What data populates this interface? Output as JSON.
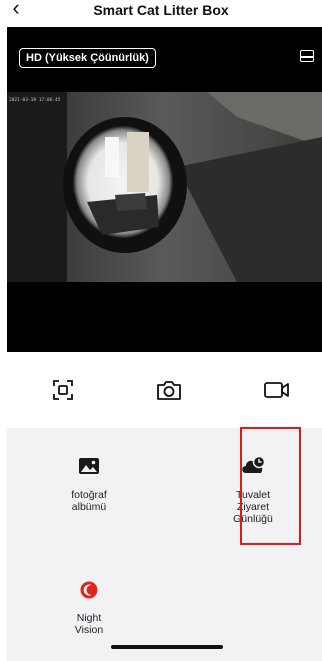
{
  "header": {
    "back_icon": "chevron-left-icon",
    "title": "Smart Cat Litter Box"
  },
  "video": {
    "quality_label": "HD (Yüksek Çöünürlük)",
    "timestamp": "2021-03-18 17:06:45",
    "layout_icon": "layout-toggle-icon"
  },
  "toolbar": {
    "items": [
      {
        "name": "fullscreen",
        "icon": "fullscreen-icon"
      },
      {
        "name": "screenshot",
        "icon": "camera-icon"
      },
      {
        "name": "record",
        "icon": "video-record-icon"
      }
    ]
  },
  "features": [
    {
      "label": "fotoğraf\nalbümü",
      "icon": "photo-album-icon",
      "icon_color": "#1a1a1a"
    },
    {
      "label": "Tuvalet\nZiyaret\nGünlüğü",
      "icon": "cloud-clock-icon",
      "icon_color": "#1a1a1a"
    },
    {
      "label": "Night\nVision",
      "icon": "moon-icon",
      "icon_color": "#e5231b"
    }
  ],
  "colors": {
    "highlight": "#e01919",
    "night_vision": "#e5231b",
    "panel_bg": "#f2f2f4"
  }
}
